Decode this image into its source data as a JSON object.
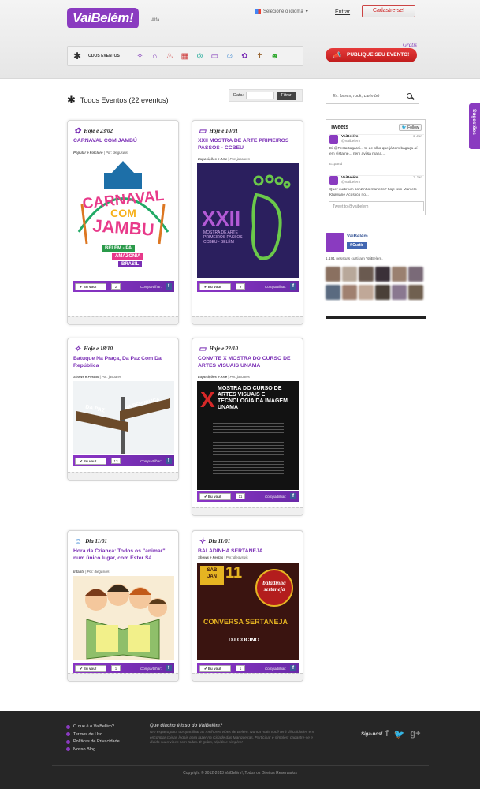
{
  "header": {
    "logo_text": "VaiBelém!",
    "logo_badge": "Alfa",
    "language": "Selecione o idioma",
    "login": "Entrar",
    "signup": "Cadastre-se!",
    "categories_all": "TODOS EVENTOS",
    "publish": "PUBLIQUE SEU EVENTO!",
    "publish_badge": "Grátis"
  },
  "main": {
    "title": "Todos Eventos (22 eventos)",
    "date_label": "Data:",
    "filter_button": "Filtrar",
    "search_placeholder": "Ex: bares, rock, carimbó"
  },
  "events": [
    {
      "date": "Hoje e 23/02",
      "title": "CARNAVAL COM JAMBÚ",
      "category": "Popular e Folclore",
      "by": "| Por: dieguswis",
      "count": "2",
      "icon": "folklore-icon"
    },
    {
      "date": "Hoje e 10/01",
      "title": "XXII MOSTRA DE ARTE PRIMEIROS PASSOS - CCBEU",
      "category": "Exposições e Arte",
      "by": "| Por: jasoares",
      "count": "9",
      "icon": "tv-icon"
    },
    {
      "date": "Hoje e 18/10",
      "title": "Batuque Na Praça, Da Paz Com Da República",
      "category": "Shows e Festas",
      "by": "| Por: jasoares",
      "count": "13",
      "icon": "dance-icon"
    },
    {
      "date": "Hoje e 22/10",
      "title": "CONVITE X MOSTRA DO CURSO DE ARTES VISUAIS UNAMA",
      "category": "Exposições e Arte",
      "by": "| Por: jasoares",
      "count": "11",
      "icon": "tv-icon"
    },
    {
      "date": "Dia 11/01",
      "title": "Hora da Criança: Todos os \"animar\" num único lugar, com Ester Sá",
      "category": "Infantil",
      "by": "| Por: dieguswis",
      "count": "1",
      "icon": "child-icon"
    },
    {
      "date": "Dia 11/01",
      "title": "BALADINHA SERTANEJA",
      "category": "Shows e Festas",
      "by": "| Por: dieguswis",
      "count": "1",
      "icon": "dance-icon"
    }
  ],
  "card_labels": {
    "going": "Eu vou!",
    "share": "Compartilhar:"
  },
  "poster_text": {
    "carnaval1": "CARNAVAL",
    "carnaval2": "COM",
    "carnaval3": "JAMBU",
    "belem": "BELÉM - PA",
    "amazonia": "AMAZÔNIA",
    "brasil": "BRASIL",
    "xxii": "XXII",
    "mostra": "MOSTRA DE ARTE PRIMEIROS PASSOS CCBEU - BELÉM",
    "street1": "DA PAZ",
    "street2": "DA REPÚBLICA",
    "unama": "MOSTRA DO CURSO DE ARTES VISUAIS E TECNOLOGIA DA IMAGEM UNAMA",
    "sab": "SÁB",
    "jan": "JAN",
    "eleven": "11",
    "baladinha": "baladinha sertaneja",
    "conversa": "CONVERSA SERTANEJA",
    "dj": "DJ COCINO"
  },
  "sidebar": {
    "tweets_title": "Tweets",
    "follow": "Follow",
    "tweet1": {
      "name": "VaiBelém",
      "handle": "@vaibelem",
      "date": "2 Jan",
      "text": "Ei @FestaBagarai... to de olho que já tem bagaça aí em vista né... nem aviisa mana....",
      "expand": "Expand"
    },
    "tweet2": {
      "name": "VaiBelém",
      "handle": "@vaibelem",
      "date": "2 Jan",
      "text": "Quer curtir um sonzinho maneiro? hoje tem Marcelo Khawane Acústico no..."
    },
    "tweet_input": "Tweet to @vaibelem",
    "fb_name": "VaiBelém",
    "fb_like": "Curtir",
    "fb_people": "1.191 pessoas curtiram VaiBelém."
  },
  "suggestions_tab": "Sugestões",
  "footer": {
    "links": [
      "O que é o VaiBelém?",
      "Termos de Uso",
      "Políticas de Privacidade",
      "Nosso Blog"
    ],
    "question": "Que diacho é isso do VaiBelém?",
    "description": "Um espaço para compartilhar as melhores vibes de Belém. Nunca mais você terá dificuldades em encontrar coisas legais para fazer na Cidade das Mangueiras. Participar é simples: cadastre-se e divida suas vibes com todos. É grátis, rápido e simples!",
    "follow_us": "Siga-nos!",
    "copyright": "Copyright © 2012-2013 VaiBelém!, Todos os Direitos Reservados"
  }
}
